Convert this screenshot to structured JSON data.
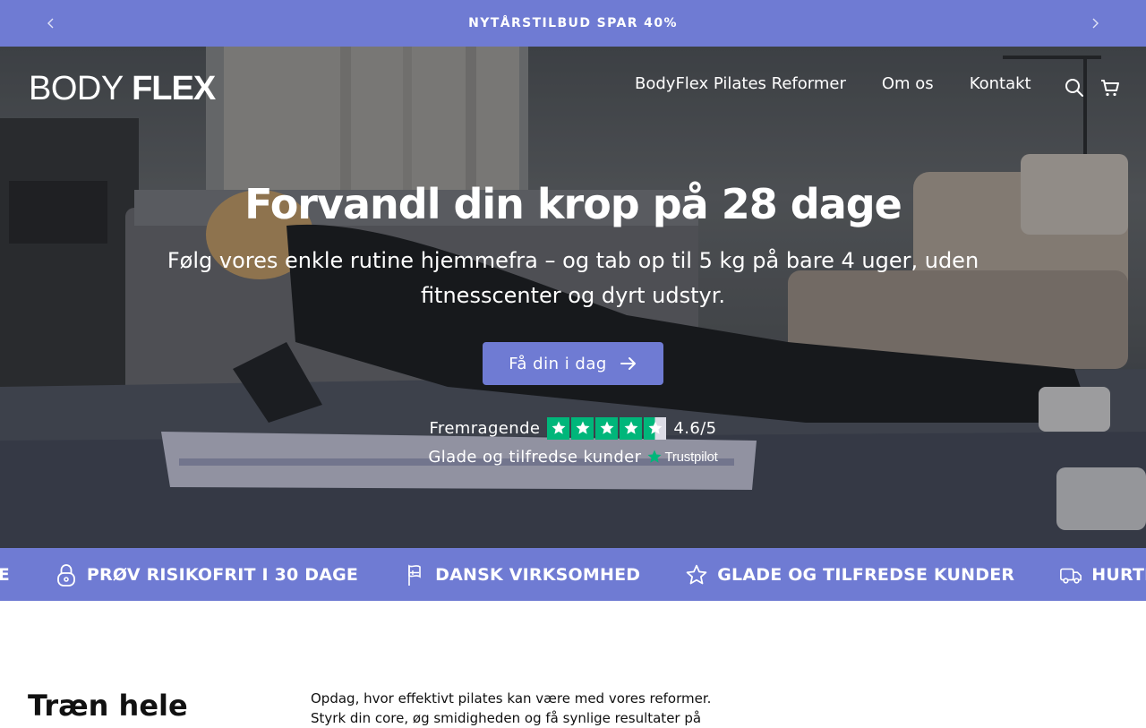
{
  "announcement": {
    "text": "NYTÅRSTILBUD SPAR 40%",
    "prev_icon": "chevron-left-icon",
    "next_icon": "chevron-right-icon"
  },
  "header": {
    "logo_light": "BODY",
    "logo_bold": "FLEX",
    "nav": [
      {
        "label": "BodyFlex Pilates Reformer"
      },
      {
        "label": "Om os"
      },
      {
        "label": "Kontakt"
      }
    ],
    "icons": [
      "search-icon",
      "cart-icon"
    ]
  },
  "hero": {
    "title": "Forvandl din krop på 28 dage",
    "subtitle": "Følg vores enkle rutine hjemmefra – og tab op til 5 kg på bare 4 uger, uden fitnesscenter og dyrt udstyr.",
    "cta_label": "Få din i dag",
    "rating_label": "Fremragende",
    "rating_score": "4.6/5",
    "rating_value": 4.6,
    "reviews_label": "Glade og tilfredse kunder",
    "trustpilot_label": "Trustpilot"
  },
  "strip": {
    "items": [
      {
        "icon": "",
        "label": "AGE"
      },
      {
        "icon": "lock-icon",
        "label": "PRØV RISIKOFRIT I 30 DAGE"
      },
      {
        "icon": "flag-icon",
        "label": "DANSK VIRKSOMHED"
      },
      {
        "icon": "star-icon",
        "label": "GLADE OG TILFREDSE KUNDER"
      },
      {
        "icon": "truck-icon",
        "label": "HURTIG LEVERING"
      }
    ]
  },
  "section": {
    "heading": "Træn hele",
    "body": "Opdag, hvor effektivt pilates kan være med vores reformer. Styrk din core, øg smidigheden og få synlige resultater på"
  },
  "colors": {
    "accent": "#6f7bd3",
    "trustpilot_green": "#00b67a",
    "text": "#111111",
    "white": "#ffffff"
  }
}
